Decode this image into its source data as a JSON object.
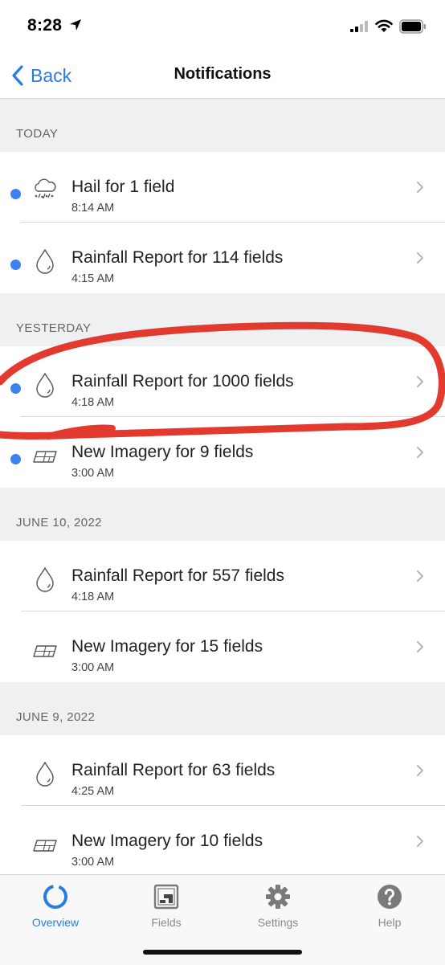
{
  "status_bar": {
    "time": "8:28"
  },
  "nav": {
    "back_label": "Back",
    "title": "Notifications"
  },
  "sections": [
    {
      "header": "TODAY"
    },
    {
      "header": "YESTERDAY"
    },
    {
      "header": "JUNE 10, 2022"
    },
    {
      "header": "JUNE 9, 2022"
    }
  ],
  "rows": [
    {
      "title": "Hail for 1 field",
      "time": "8:14 AM",
      "icon": "hail-icon",
      "unread": true
    },
    {
      "title": "Rainfall Report for 114 fields",
      "time": "4:15 AM",
      "icon": "raindrop-icon",
      "unread": true
    },
    {
      "title": "Rainfall Report for 1000 fields",
      "time": "4:18 AM",
      "icon": "raindrop-icon",
      "unread": true
    },
    {
      "title": "New Imagery for 9 fields",
      "time": "3:00 AM",
      "icon": "imagery-icon",
      "unread": true
    },
    {
      "title": "Rainfall Report for 557 fields",
      "time": "4:18 AM",
      "icon": "raindrop-icon",
      "unread": false
    },
    {
      "title": "New Imagery for 15 fields",
      "time": "3:00 AM",
      "icon": "imagery-icon",
      "unread": false
    },
    {
      "title": "Rainfall Report for 63 fields",
      "time": "4:25 AM",
      "icon": "raindrop-icon",
      "unread": false
    },
    {
      "title": "New Imagery for 10 fields",
      "time": "3:00 AM",
      "icon": "imagery-icon",
      "unread": false
    }
  ],
  "tabs": [
    {
      "label": "Overview",
      "icon": "overview-ring-icon",
      "active": true
    },
    {
      "label": "Fields",
      "icon": "fields-icon",
      "active": false
    },
    {
      "label": "Settings",
      "icon": "gear-icon",
      "active": false
    },
    {
      "label": "Help",
      "icon": "help-icon",
      "active": false
    }
  ],
  "colors": {
    "accent": "#2b7be3",
    "unread_dot": "#3b82f0",
    "annotation": "#e23a2e",
    "section_bg": "#eef0f1"
  }
}
